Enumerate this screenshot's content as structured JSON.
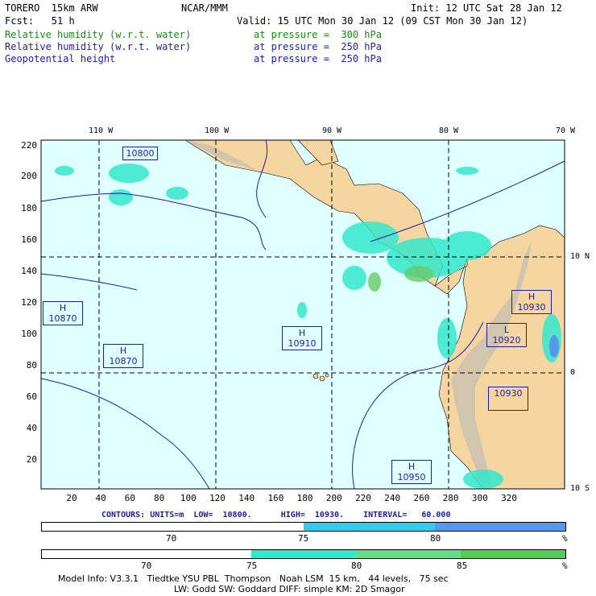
{
  "header": {
    "model": "TORERO  15km ARW",
    "org": "NCAR/MMM",
    "init": "Init: 12 UTC Sat 28 Jan 12",
    "fcst_label": "Fcst:   51 h",
    "valid": "Valid: 15 UTC Mon 30 Jan 12 (09 CST Mon 30 Jan 12)",
    "fields": [
      {
        "name": "Relative humidity (w.r.t. water)",
        "level": "at pressure =  300 hPa"
      },
      {
        "name": "Relative humidity (w.r.t. water)",
        "level": "at pressure =  250 hPa"
      },
      {
        "name": "Geopotential height",
        "level": "at pressure =  250 hPa"
      }
    ]
  },
  "map": {
    "lon_labels": [
      "110 W",
      "100 W",
      "90 W",
      "80 W",
      "70 W"
    ],
    "lat_labels": [
      "10 N",
      "0",
      "10 S"
    ],
    "x_ticks": [
      "20",
      "40",
      "60",
      "80",
      "100",
      "120",
      "140",
      "160",
      "180",
      "200",
      "220",
      "240",
      "260",
      "280",
      "300",
      "320"
    ],
    "y_ticks": [
      "220",
      "200",
      "180",
      "160",
      "140",
      "120",
      "100",
      "80",
      "60",
      "40",
      "20"
    ],
    "pressure_centers": [
      {
        "type": "H",
        "value": "10870"
      },
      {
        "type": "H",
        "value": "10870"
      },
      {
        "type": "H",
        "value": "10910"
      },
      {
        "type": "H",
        "value": "10950"
      },
      {
        "type": "H",
        "value": "10930"
      },
      {
        "type": "L",
        "value": "10920"
      },
      {
        "type": "",
        "value": "10930"
      },
      {
        "type": "",
        "value": "10800"
      }
    ],
    "colors": {
      "ocean": "#e0ffff",
      "land": "#f5d6a0",
      "grid": "#000000"
    }
  },
  "contours": {
    "label": "CONTOURS: UNITS=m  LOW=  10800.      HIGH=  10930.    INTERVAL=   60.000"
  },
  "colorbar1": {
    "ticks": [
      "70",
      "75",
      "80",
      "%"
    ],
    "colors": [
      "#ffffff",
      "#ffffff",
      "#33ccee",
      "#5599ee"
    ]
  },
  "colorbar2": {
    "ticks": [
      "70",
      "75",
      "80",
      "85",
      "%"
    ],
    "colors": [
      "#ffffff",
      "#ffffff",
      "#33e8cc",
      "#66dd88",
      "#55cc55"
    ]
  },
  "footer": {
    "line1": "Model Info: V3.3.1   Tiedtke YSU PBL  Thompson   Noah LSM  15 km,   44 levels,   75 sec",
    "line2": "LW: Godd SW: Goddard DIFF: simple KM: 2D Smagor"
  }
}
